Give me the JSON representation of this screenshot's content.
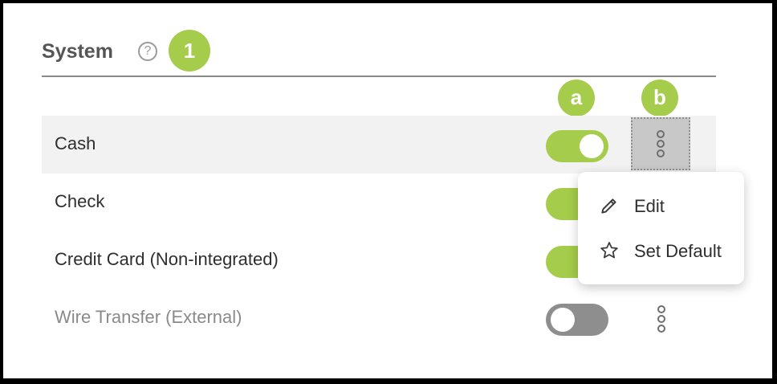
{
  "section": {
    "title": "System",
    "help_icon": "question-circle-icon"
  },
  "callouts": {
    "main": "1",
    "toggle_col": "a",
    "menu_col": "b"
  },
  "colors": {
    "accent": "#a5cc4a",
    "toggle_off": "#8e8e8e"
  },
  "payment_methods": [
    {
      "label": "Cash",
      "enabled": true
    },
    {
      "label": "Check",
      "enabled": true
    },
    {
      "label": "Credit Card (Non-integrated)",
      "enabled": true
    },
    {
      "label": "Wire Transfer (External)",
      "enabled": false
    }
  ],
  "context_menu": {
    "items": [
      {
        "label": "Edit",
        "icon": "pencil-icon"
      },
      {
        "label": "Set Default",
        "icon": "star-icon"
      }
    ]
  }
}
